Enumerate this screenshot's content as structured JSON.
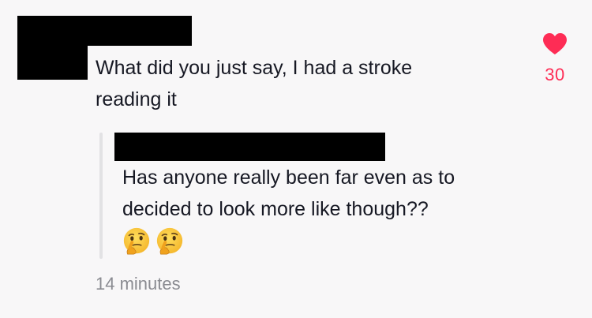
{
  "comment": {
    "text": "What did you just say, I had a stroke\nreading it",
    "likes": "30"
  },
  "reply": {
    "text": "Has anyone really been far even as to decided to look more like though??",
    "emojis": [
      "thinking-face",
      "thinking-face"
    ]
  },
  "timestamp": "14 minutes",
  "colors": {
    "accent_like": "#fe2c55",
    "text": "#161823",
    "muted": "#8a8b91",
    "background": "#f8f7f8"
  }
}
